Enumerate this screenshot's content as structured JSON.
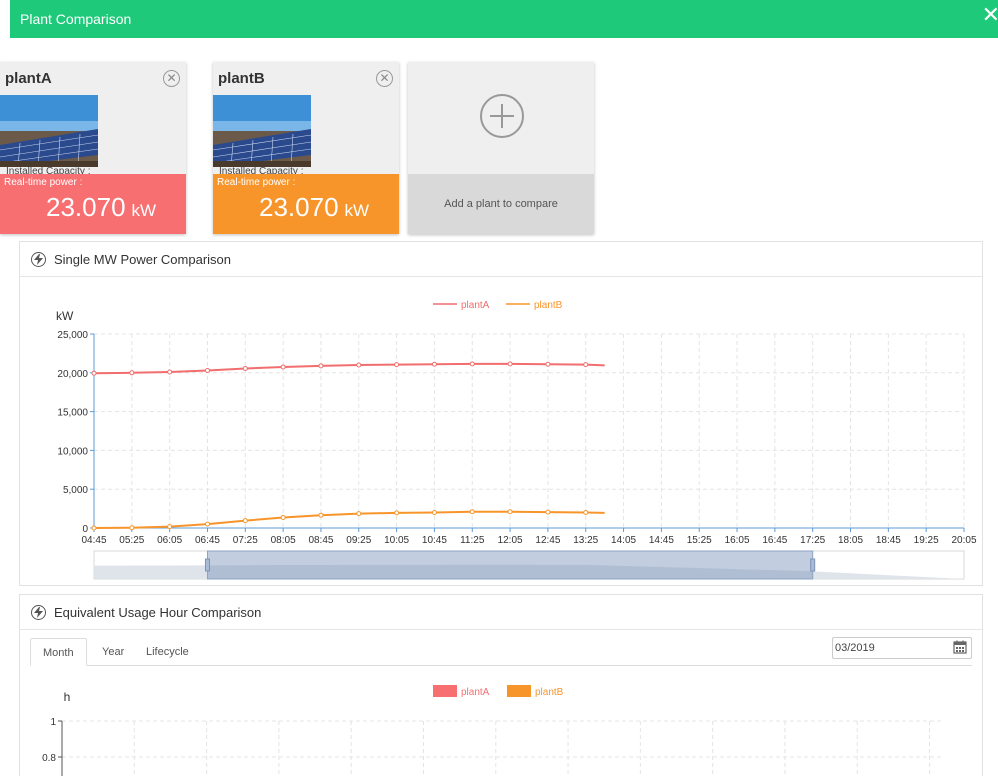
{
  "window": {
    "title": "Plant Comparison",
    "close_glyph": "✕"
  },
  "plants": [
    {
      "name": "plantA",
      "capacity_label": "Installed Capacity :",
      "power_label": "Real-time power :",
      "power_value": "23.070",
      "power_unit": "kW",
      "color": "#f86f72"
    },
    {
      "name": "plantB",
      "capacity_label": "Installed Capacity :",
      "power_label": "Real-time power :",
      "power_value": "23.070",
      "power_unit": "kW",
      "color": "#f7952a"
    }
  ],
  "add_plant": {
    "label": "Add a plant to compare"
  },
  "power_panel": {
    "title": "Single MW Power Comparison"
  },
  "usage_panel": {
    "title": "Equivalent Usage Hour Comparison",
    "tabs": [
      "Month",
      "Year",
      "Lifecycle"
    ],
    "active_tab": "Month",
    "date_value": "03/2019"
  },
  "chart_data": [
    {
      "type": "line",
      "ylabel": "kW",
      "ylim": [
        0,
        25000
      ],
      "yticks": [
        "0",
        "5,000",
        "10,000",
        "15,000",
        "20,000",
        "25,000"
      ],
      "xticks": [
        "04:45",
        "05:25",
        "06:05",
        "06:45",
        "07:25",
        "08:05",
        "08:45",
        "09:25",
        "10:05",
        "10:45",
        "11:25",
        "12:05",
        "12:45",
        "13:25",
        "14:05",
        "14:45",
        "15:25",
        "16:05",
        "16:45",
        "17:25",
        "18:05",
        "18:45",
        "19:25",
        "20:05"
      ],
      "grid": true,
      "legend": "top-center",
      "series": [
        {
          "name": "plantA",
          "color": "#f26d6d",
          "x": [
            "04:45",
            "05:25",
            "06:05",
            "06:45",
            "07:25",
            "08:05",
            "08:45",
            "09:25",
            "10:05",
            "10:45",
            "11:25",
            "12:05",
            "12:45",
            "13:25"
          ],
          "values": [
            19950,
            20000,
            20100,
            20300,
            20550,
            20750,
            20900,
            21000,
            21050,
            21100,
            21150,
            21150,
            21100,
            21050
          ],
          "end": {
            "x": "13:45",
            "value": 20950
          }
        },
        {
          "name": "plantB",
          "color": "#f7952a",
          "x": [
            "04:45",
            "05:25",
            "06:05",
            "06:45",
            "07:25",
            "08:05",
            "08:45",
            "09:25",
            "10:05",
            "10:45",
            "11:25",
            "12:05",
            "12:45",
            "13:25"
          ],
          "values": [
            0,
            30,
            180,
            500,
            950,
            1350,
            1650,
            1850,
            1950,
            2000,
            2100,
            2100,
            2050,
            2000
          ],
          "end": {
            "x": "13:45",
            "value": 1950
          }
        }
      ],
      "zoom_window": {
        "start": "06:45",
        "end": "17:25"
      }
    },
    {
      "type": "bar",
      "ylabel": "h",
      "ylim": [
        0,
        1
      ],
      "yticks": [
        "0.8",
        "1"
      ],
      "grid": true,
      "legend": "top-center",
      "series": [
        {
          "name": "plantA",
          "color": "#f86f72",
          "values": []
        },
        {
          "name": "plantB",
          "color": "#f7952a",
          "values": []
        }
      ]
    }
  ]
}
